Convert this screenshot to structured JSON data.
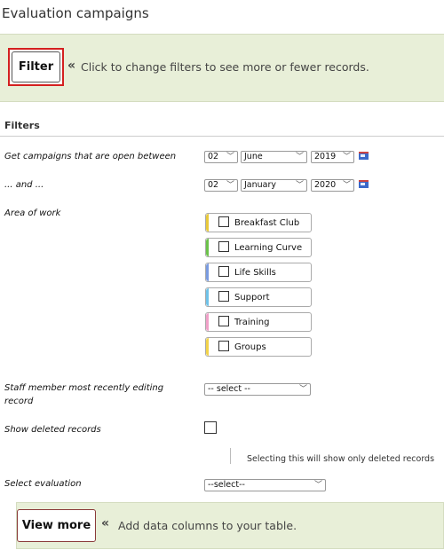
{
  "page": {
    "title": "Evaluation campaigns"
  },
  "filter_bar": {
    "button_label": "Filter",
    "hint_arrow": "«",
    "hint_text": "Click to change filters to see more or fewer records."
  },
  "filters": {
    "section_title": "Filters",
    "open_between_label": "Get campaigns that are open between",
    "start": {
      "day": "02",
      "month": "June",
      "year": "2019"
    },
    "and_label": "... and ...",
    "end": {
      "day": "02",
      "month": "January",
      "year": "2020"
    },
    "area_of_work": {
      "label": "Area of work",
      "items": [
        {
          "label": "Breakfast Club",
          "color": "#e8c93a",
          "checked": false
        },
        {
          "label": "Learning Curve",
          "color": "#6cc24a",
          "checked": false
        },
        {
          "label": "Life Skills",
          "color": "#7a9be0",
          "checked": false
        },
        {
          "label": "Support",
          "color": "#6fc2e8",
          "checked": false
        },
        {
          "label": "Training",
          "color": "#f0a0c8",
          "checked": false
        },
        {
          "label": "Groups",
          "color": "#f2d34a",
          "checked": false
        }
      ]
    },
    "staff_label": "Staff member most recently editing record",
    "staff_select": "-- select --",
    "deleted_label": "Show deleted records",
    "deleted_note": "Selecting this will show only deleted records",
    "evaluation_label": "Select evaluation",
    "evaluation_select": "--select--"
  },
  "view_more": {
    "button_label": "View more",
    "hint_arrow": "«",
    "hint_text": "Add data columns to your table."
  }
}
